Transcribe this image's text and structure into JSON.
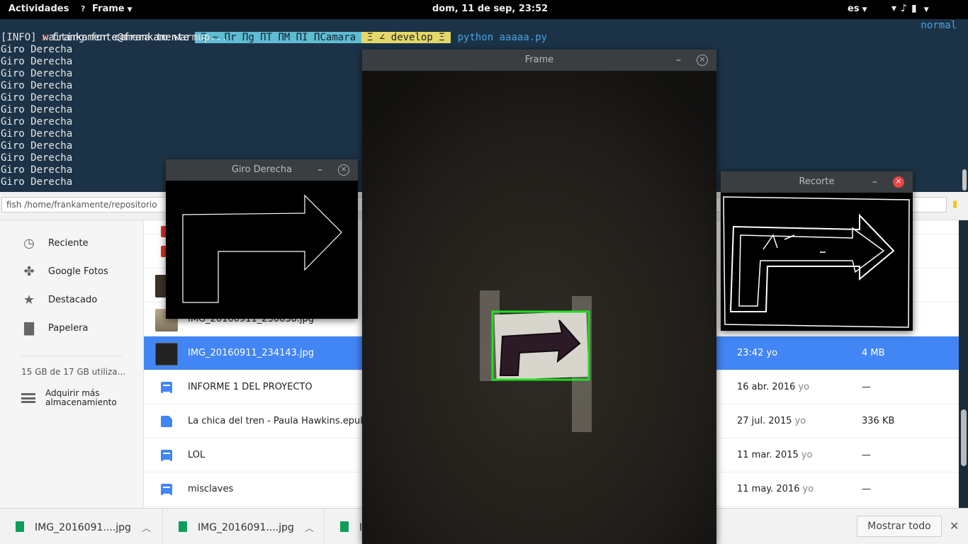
{
  "topbar": {
    "activities": "Actividades",
    "app_name": "Frame",
    "clock": "dom, 11 de sep, 23:52",
    "language": "es"
  },
  "terminal": {
    "prompt_x": "✗",
    "user_host": "frankamente@frankamente",
    "path": "Ξ ~ Πr Πg ΠT ΠM ΠI ΠCamara",
    "git": "Ξ ∠ develop Ξ",
    "command": "python aaaaa.py",
    "mode": "normal",
    "lines": [
      "[INFO] waiting for camera to warmup...",
      "Giro Derecha",
      "Giro Derecha",
      "Giro Derecha",
      "Giro Derecha",
      "Giro Derecha",
      "Giro Derecha",
      "Giro Derecha",
      "Giro Derecha",
      "Giro Derecha",
      "Giro Derecha",
      "Giro Derecha",
      "Giro Derecha"
    ]
  },
  "chrome": {
    "url": "fish  /home/frankamente/repositorio"
  },
  "drive": {
    "sidebar": [
      {
        "label": "Reciente",
        "icon": "clock-icon"
      },
      {
        "label": "Google Fotos",
        "icon": "pinwheel-icon"
      },
      {
        "label": "Destacado",
        "icon": "star-icon"
      },
      {
        "label": "Papelera",
        "icon": "trash-icon"
      }
    ],
    "quota": "15 GB de 17 GB utiliza...",
    "buy_storage": "Adquirir más almacenamiento",
    "files": [
      {
        "name": "IMG_20160911_230038.jpg",
        "date": "",
        "owner": "",
        "size": "",
        "kind": "photo"
      },
      {
        "name": "IMG_20160911_234143.jpg",
        "date": "23:42",
        "owner": "yo",
        "size": "4 MB",
        "kind": "photo-dark",
        "selected": true
      },
      {
        "name": "INFORME 1 DEL PROYECTO",
        "date": "16 abr. 2016",
        "owner": "yo",
        "size": "—",
        "kind": "doc"
      },
      {
        "name": "La chica del tren - Paula Hawkins.epub",
        "date": "27 jul. 2015",
        "owner": "yo",
        "size": "336 KB",
        "kind": "epub"
      },
      {
        "name": "LOL",
        "date": "11 mar. 2015",
        "owner": "yo",
        "size": "—",
        "kind": "doc"
      },
      {
        "name": "misclaves",
        "date": "11 may. 2016",
        "owner": "yo",
        "size": "—",
        "kind": "doc"
      }
    ]
  },
  "downloads": {
    "items": [
      "IMG_2016091....jpg",
      "IMG_2016091....jpg",
      "IM"
    ],
    "show_all": "Mostrar todo"
  },
  "windows": {
    "giro": {
      "title": "Giro Derecha"
    },
    "frame": {
      "title": "Frame"
    },
    "recorte": {
      "title": "Recorte"
    }
  },
  "colors": {
    "terminal_bg": "#1c3347",
    "selected_row": "#4285f4",
    "detection_box": "#22dd22"
  }
}
